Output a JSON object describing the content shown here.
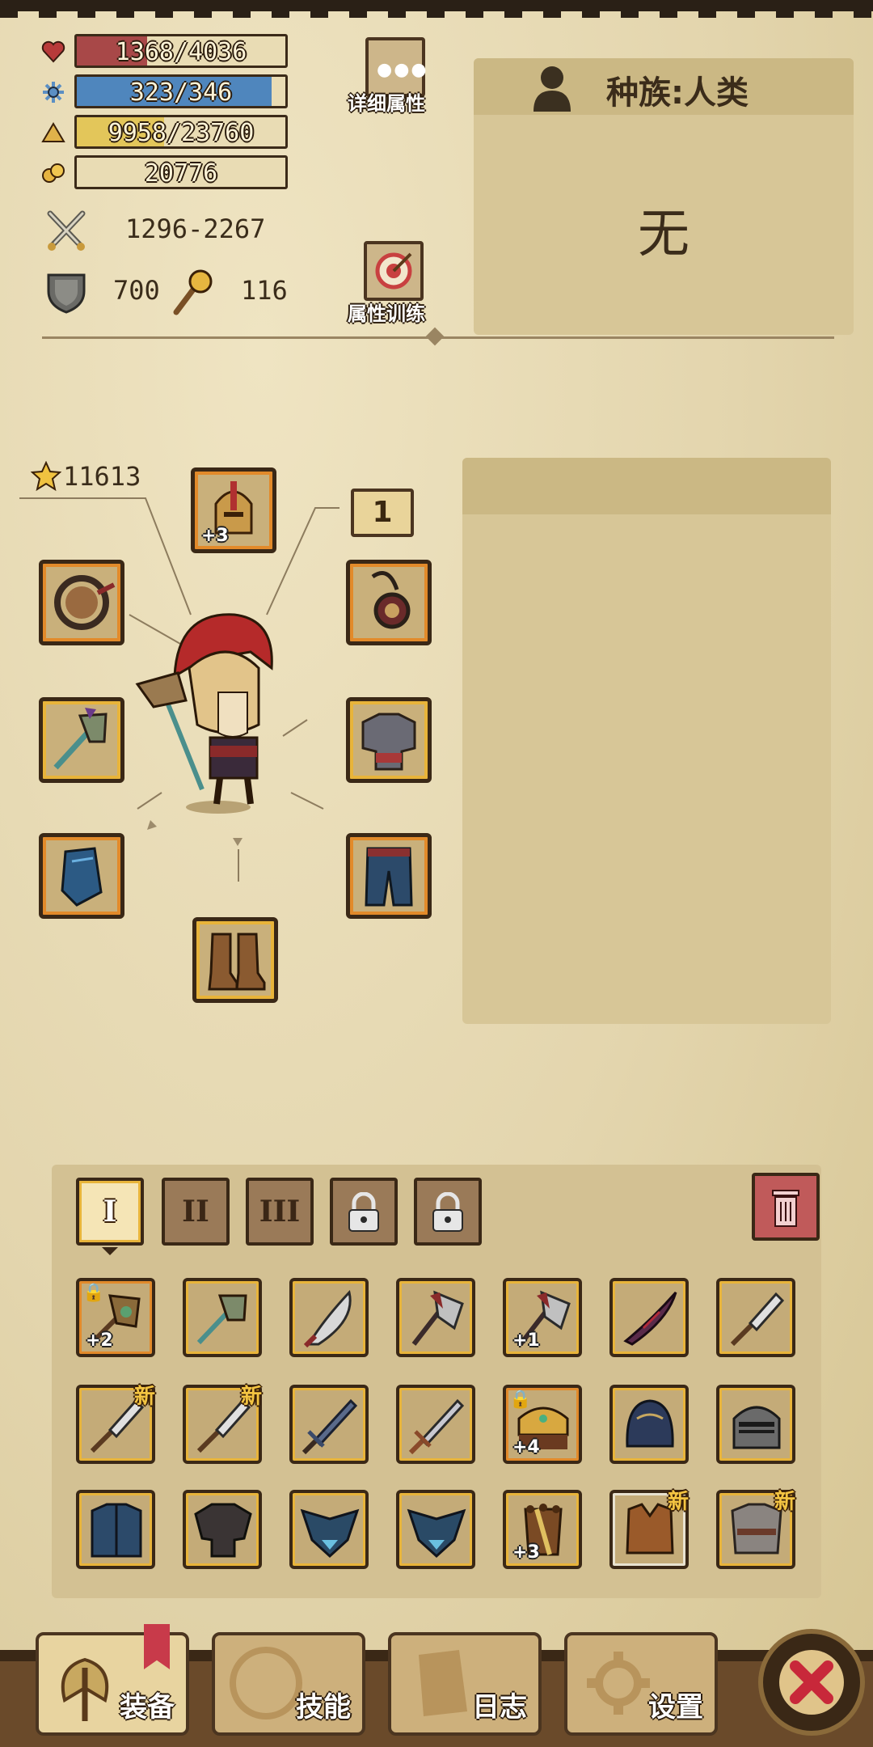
{
  "stats": {
    "hp": {
      "icon": "heart-icon",
      "text": "1368/4036",
      "fraction": 0.339,
      "color": "#a84848"
    },
    "mp": {
      "icon": "gear-flower-icon",
      "text": "323/346",
      "fraction": 0.934,
      "color": "#4f86bd"
    },
    "xp": {
      "icon": "triangle-icon",
      "text": "9958/23760",
      "fraction": 0.419,
      "color": "#e3c65a"
    },
    "gold": {
      "icon": "coins-icon",
      "text": "20776"
    },
    "attack": {
      "icon": "crossed-swords-icon",
      "text": "1296-2267"
    },
    "defense": {
      "icon": "shield-icon",
      "text": "700"
    },
    "magic": {
      "icon": "wand-icon",
      "text": "116"
    }
  },
  "buttons": {
    "details": "详细属性",
    "training": "属性训练"
  },
  "race_panel": {
    "title": "种族:人类",
    "value": "无"
  },
  "equipment": {
    "score": "11613",
    "level_badge": "1",
    "helmet_plus": "+3"
  },
  "tabs": [
    "I",
    "II",
    "III"
  ],
  "inventory": {
    "new_label": "新",
    "plus2": "+2",
    "plus1": "+1",
    "plus4": "+4",
    "plus3": "+3"
  },
  "nav": {
    "equip": "装备",
    "skills": "技能",
    "log": "日志",
    "settings": "设置"
  },
  "colors": {
    "rarity_orange": "#e28a2a",
    "rarity_gold": "#e8b43a",
    "close_red": "#c8283a"
  }
}
